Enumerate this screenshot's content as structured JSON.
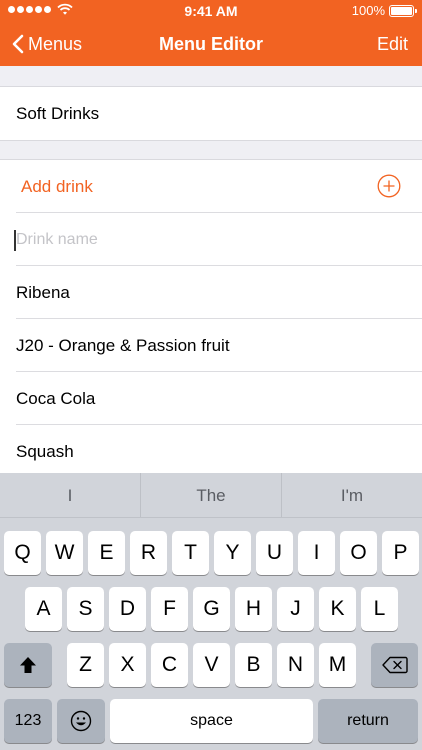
{
  "status_bar": {
    "time": "9:41 AM",
    "battery": "100%"
  },
  "nav": {
    "back_label": "Menus",
    "title": "Menu Editor",
    "edit_label": "Edit"
  },
  "menu": {
    "name": "Soft Drinks"
  },
  "drinks": {
    "add_label": "Add drink",
    "input_placeholder": "Drink name",
    "input_value": "",
    "items": [
      "Ribena",
      "J20 - Orange & Passion fruit",
      "Coca Cola",
      "Squash"
    ]
  },
  "keyboard": {
    "suggestions": [
      "I",
      "The",
      "I'm"
    ],
    "rows": [
      [
        "Q",
        "W",
        "E",
        "R",
        "T",
        "Y",
        "U",
        "I",
        "O",
        "P"
      ],
      [
        "A",
        "S",
        "D",
        "F",
        "G",
        "H",
        "J",
        "K",
        "L"
      ],
      [
        "Z",
        "X",
        "C",
        "V",
        "B",
        "N",
        "M"
      ]
    ],
    "numbers_label": "123",
    "space_label": "space",
    "return_label": "return"
  },
  "colors": {
    "accent": "#f26322"
  }
}
